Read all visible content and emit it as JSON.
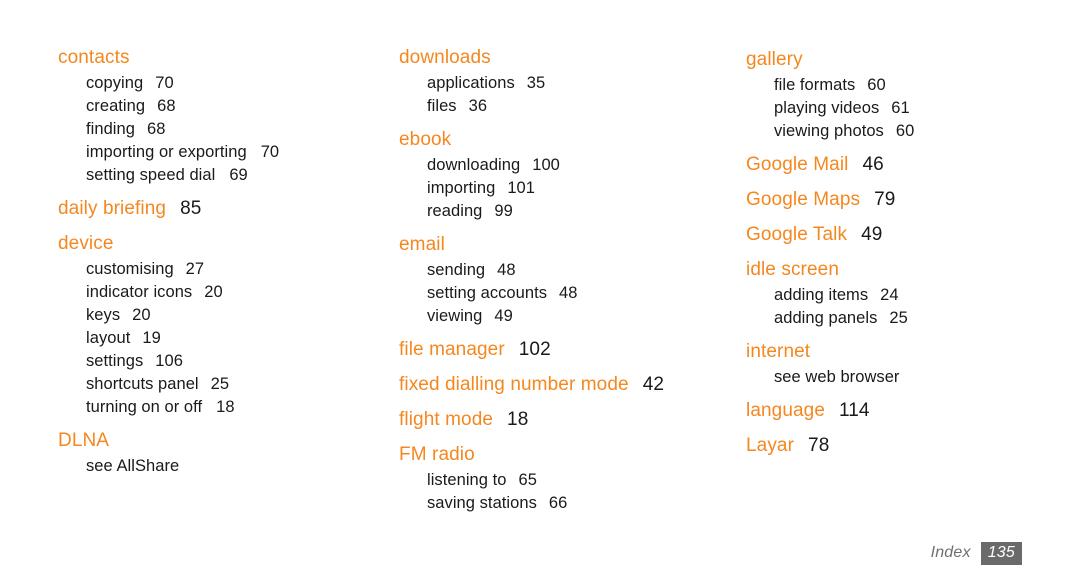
{
  "document": {
    "footer": {
      "label": "Index",
      "page_number": "135"
    },
    "colors": {
      "heading": "#f5871f",
      "body_text": "#1a1a1a",
      "footer_text": "#6f6f6f",
      "footer_badge_bg": "#6a6a6a",
      "page_background": "#ffffff"
    }
  },
  "columns": [
    {
      "groups": [
        {
          "heading": "contacts",
          "heading_page": "",
          "subentries": [
            {
              "label": "copying",
              "page": "70"
            },
            {
              "label": "creating",
              "page": "68"
            },
            {
              "label": "finding",
              "page": "68"
            },
            {
              "label": "importing or exporting",
              "page": "70"
            },
            {
              "label": "setting speed dial",
              "page": "69"
            }
          ]
        },
        {
          "heading": "daily briefing",
          "heading_page": "85",
          "subentries": []
        },
        {
          "heading": "device",
          "heading_page": "",
          "subentries": [
            {
              "label": "customising",
              "page": "27"
            },
            {
              "label": "indicator icons",
              "page": "20"
            },
            {
              "label": "keys",
              "page": "20"
            },
            {
              "label": "layout",
              "page": "19"
            },
            {
              "label": "settings",
              "page": "106"
            },
            {
              "label": "shortcuts panel",
              "page": "25"
            },
            {
              "label": "turning on or off",
              "page": "18"
            }
          ]
        },
        {
          "heading": "DLNA",
          "heading_page": "",
          "subentries": [
            {
              "label": "see AllShare",
              "page": ""
            }
          ]
        }
      ]
    },
    {
      "groups": [
        {
          "heading": "downloads",
          "heading_page": "",
          "subentries": [
            {
              "label": "applications",
              "page": "35"
            },
            {
              "label": "files",
              "page": "36"
            }
          ]
        },
        {
          "heading": "ebook",
          "heading_page": "",
          "subentries": [
            {
              "label": "downloading",
              "page": "100"
            },
            {
              "label": "importing",
              "page": "101"
            },
            {
              "label": "reading",
              "page": "99"
            }
          ]
        },
        {
          "heading": "email",
          "heading_page": "",
          "subentries": [
            {
              "label": "sending",
              "page": "48"
            },
            {
              "label": "setting accounts",
              "page": "48"
            },
            {
              "label": "viewing",
              "page": "49"
            }
          ]
        },
        {
          "heading": "file manager",
          "heading_page": "102",
          "subentries": []
        },
        {
          "heading": "fixed dialling number mode",
          "heading_page": "42",
          "subentries": []
        },
        {
          "heading": "flight mode",
          "heading_page": "18",
          "subentries": []
        },
        {
          "heading": "FM radio",
          "heading_page": "",
          "subentries": [
            {
              "label": "listening to",
              "page": "65"
            },
            {
              "label": "saving stations",
              "page": "66"
            }
          ]
        }
      ]
    },
    {
      "groups": [
        {
          "heading": "gallery",
          "heading_page": "",
          "subentries": [
            {
              "label": "file formats",
              "page": "60"
            },
            {
              "label": "playing videos",
              "page": "61"
            },
            {
              "label": "viewing photos",
              "page": "60"
            }
          ]
        },
        {
          "heading": "Google Mail",
          "heading_page": "46",
          "subentries": []
        },
        {
          "heading": "Google Maps",
          "heading_page": "79",
          "subentries": []
        },
        {
          "heading": "Google Talk",
          "heading_page": "49",
          "subentries": []
        },
        {
          "heading": "idle screen",
          "heading_page": "",
          "subentries": [
            {
              "label": "adding items",
              "page": "24"
            },
            {
              "label": "adding panels",
              "page": "25"
            }
          ]
        },
        {
          "heading": "internet",
          "heading_page": "",
          "subentries": [
            {
              "label": "see web browser",
              "page": ""
            }
          ]
        },
        {
          "heading": "language",
          "heading_page": "114",
          "subentries": []
        },
        {
          "heading": "Layar",
          "heading_page": "78",
          "subentries": []
        }
      ]
    }
  ]
}
